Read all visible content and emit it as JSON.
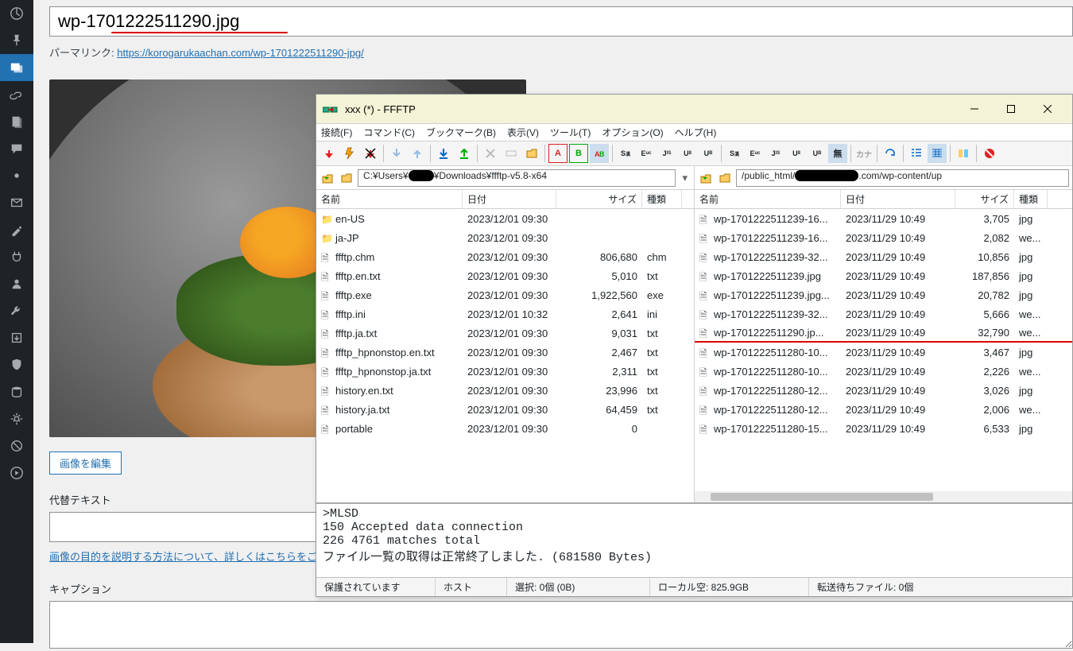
{
  "wp": {
    "title": "wp-1701222511290.jpg",
    "permalink_label": "パーマリンク:",
    "permalink_url": "https://korogarukaachan.com/wp-1701222511290-jpg/",
    "edit_image_btn": "画像を編集",
    "alt_label": "代替テキスト",
    "alt_help": "画像の目的を説明する方法について、詳しくはこちらをご",
    "caption_label": "キャプション"
  },
  "ffftp": {
    "title": "xxx (*) - FFFTP",
    "menus": [
      "接続(F)",
      "コマンド(C)",
      "ブックマーク(B)",
      "表示(V)",
      "ツール(T)",
      "オプション(O)",
      "ヘルプ(H)"
    ],
    "local_path_prefix": "C:¥Users¥",
    "local_path_suffix": "¥Downloads¥ffftp-v5.8-x64",
    "remote_path_prefix": "/public_html/",
    "remote_path_suffix": ".com/wp-content/up",
    "cols": {
      "name": "名前",
      "date": "日付",
      "size": "サイズ",
      "type": "種類"
    },
    "local_files": [
      {
        "icon": "folder",
        "name": "en-US",
        "date": "2023/12/01 09:30",
        "size": "<DIR>",
        "type": ""
      },
      {
        "icon": "folder",
        "name": "ja-JP",
        "date": "2023/12/01 09:30",
        "size": "<DIR>",
        "type": ""
      },
      {
        "icon": "doc",
        "name": "ffftp.chm",
        "date": "2023/12/01 09:30",
        "size": "806,680",
        "type": "chm"
      },
      {
        "icon": "doc",
        "name": "ffftp.en.txt",
        "date": "2023/12/01 09:30",
        "size": "5,010",
        "type": "txt"
      },
      {
        "icon": "doc",
        "name": "ffftp.exe",
        "date": "2023/12/01 09:30",
        "size": "1,922,560",
        "type": "exe"
      },
      {
        "icon": "doc",
        "name": "ffftp.ini",
        "date": "2023/12/01 10:32",
        "size": "2,641",
        "type": "ini"
      },
      {
        "icon": "doc",
        "name": "ffftp.ja.txt",
        "date": "2023/12/01 09:30",
        "size": "9,031",
        "type": "txt"
      },
      {
        "icon": "doc",
        "name": "ffftp_hpnonstop.en.txt",
        "date": "2023/12/01 09:30",
        "size": "2,467",
        "type": "txt"
      },
      {
        "icon": "doc",
        "name": "ffftp_hpnonstop.ja.txt",
        "date": "2023/12/01 09:30",
        "size": "2,311",
        "type": "txt"
      },
      {
        "icon": "doc",
        "name": "history.en.txt",
        "date": "2023/12/01 09:30",
        "size": "23,996",
        "type": "txt"
      },
      {
        "icon": "doc",
        "name": "history.ja.txt",
        "date": "2023/12/01 09:30",
        "size": "64,459",
        "type": "txt"
      },
      {
        "icon": "doc",
        "name": "portable",
        "date": "2023/12/01 09:30",
        "size": "0",
        "type": ""
      }
    ],
    "remote_files": [
      {
        "name": "wp-1701222511239-16...",
        "date": "2023/11/29 10:49",
        "size": "3,705",
        "type": "jpg",
        "hl": false
      },
      {
        "name": "wp-1701222511239-16...",
        "date": "2023/11/29 10:49",
        "size": "2,082",
        "type": "we...",
        "hl": false
      },
      {
        "name": "wp-1701222511239-32...",
        "date": "2023/11/29 10:49",
        "size": "10,856",
        "type": "jpg",
        "hl": false
      },
      {
        "name": "wp-1701222511239.jpg",
        "date": "2023/11/29 10:49",
        "size": "187,856",
        "type": "jpg",
        "hl": false
      },
      {
        "name": "wp-1701222511239.jpg...",
        "date": "2023/11/29 10:49",
        "size": "20,782",
        "type": "jpg",
        "hl": false
      },
      {
        "name": "wp-1701222511239-32...",
        "date": "2023/11/29 10:49",
        "size": "5,666",
        "type": "we...",
        "hl": false
      },
      {
        "name": "wp-1701222511290.jp...",
        "date": "2023/11/29 10:49",
        "size": "32,790",
        "type": "we...",
        "hl": true
      },
      {
        "name": "wp-1701222511280-10...",
        "date": "2023/11/29 10:49",
        "size": "3,467",
        "type": "jpg",
        "hl": false
      },
      {
        "name": "wp-1701222511280-10...",
        "date": "2023/11/29 10:49",
        "size": "2,226",
        "type": "we...",
        "hl": false
      },
      {
        "name": "wp-1701222511280-12...",
        "date": "2023/11/29 10:49",
        "size": "3,026",
        "type": "jpg",
        "hl": false
      },
      {
        "name": "wp-1701222511280-12...",
        "date": "2023/11/29 10:49",
        "size": "2,006",
        "type": "we...",
        "hl": false
      },
      {
        "name": "wp-1701222511280-15...",
        "date": "2023/11/29 10:49",
        "size": "6,533",
        "type": "jpg",
        "hl": false
      }
    ],
    "log_lines": [
      ">MLSD",
      "150 Accepted data connection",
      "226 4761 matches total",
      "ファイル一覧の取得は正常終了しました. (681580 Bytes)"
    ],
    "status": {
      "protected": "保護されています",
      "host": "ホスト",
      "selected": "選択: 0個 (0B)",
      "local_free": "ローカル空: 825.9GB",
      "queue": "転送待ちファイル: 0個"
    },
    "toolbar_encoding": [
      "無"
    ]
  }
}
